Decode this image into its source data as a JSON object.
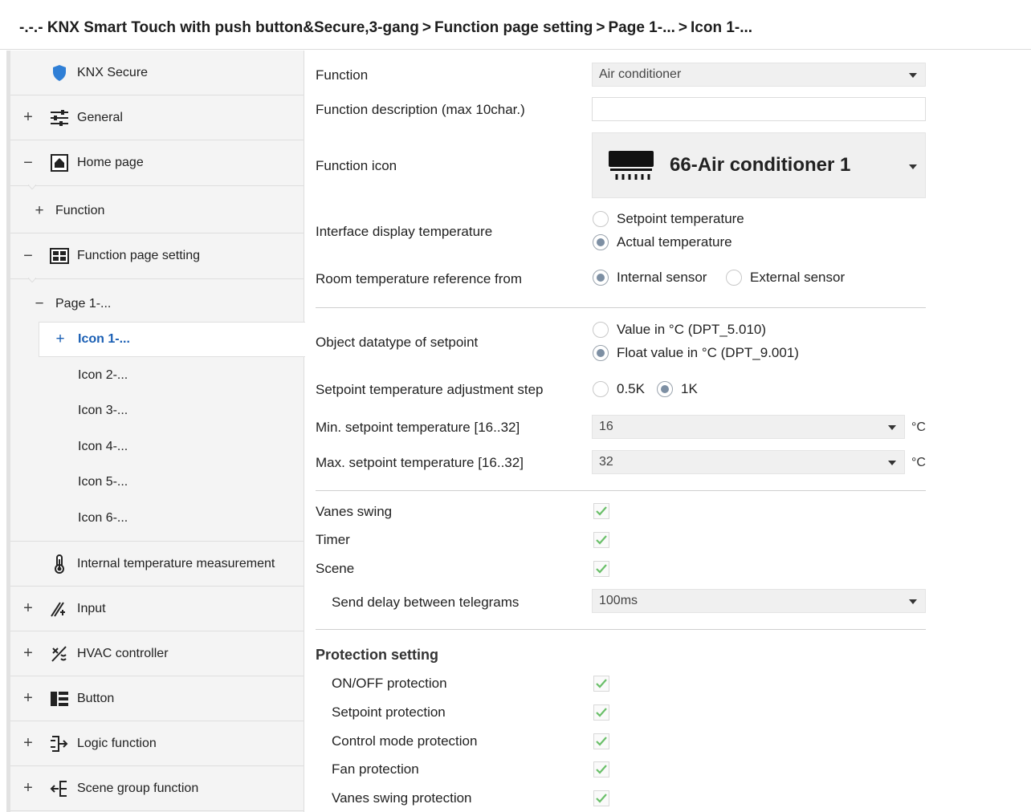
{
  "breadcrumb": {
    "parts": [
      "-.-.- KNX Smart Touch with push button&Secure,3-gang",
      "Function page setting",
      "Page 1-...",
      "Icon 1-..."
    ],
    "separator": ">"
  },
  "sidebar": {
    "items": [
      {
        "label": "KNX Secure",
        "expander": "",
        "icon": "shield-icon"
      },
      {
        "label": "General",
        "expander": "+",
        "icon": "sliders-icon"
      },
      {
        "label": "Home page",
        "expander": "−",
        "icon": "home-icon"
      },
      {
        "label": "Function",
        "expander": "+"
      },
      {
        "label": "Function page setting",
        "expander": "−",
        "icon": "grid-icon"
      },
      {
        "label": "Page 1-...",
        "expander": "−"
      },
      {
        "label": "Icon 1-...",
        "expander": "+",
        "active": true
      },
      {
        "label": "Icon 2-..."
      },
      {
        "label": "Icon 3-..."
      },
      {
        "label": "Icon 4-..."
      },
      {
        "label": "Icon 5-..."
      },
      {
        "label": "Icon 6-..."
      },
      {
        "label": "Internal temperature measurement",
        "expander": "",
        "icon": "thermometer-icon"
      },
      {
        "label": "Input",
        "expander": "+",
        "icon": "input-icon"
      },
      {
        "label": "HVAC controller",
        "expander": "+",
        "icon": "hvac-icon"
      },
      {
        "label": "Button",
        "expander": "+",
        "icon": "button-icon"
      },
      {
        "label": "Logic function",
        "expander": "+",
        "icon": "logic-icon"
      },
      {
        "label": "Scene group function",
        "expander": "+",
        "icon": "scene-group-icon"
      }
    ],
    "accent_color": "#1a5fb4",
    "shield_color": "#2f7fd6"
  },
  "form": {
    "function": {
      "label": "Function",
      "value": "Air conditioner"
    },
    "function_description": {
      "label": "Function description (max 10char.)",
      "value": ""
    },
    "function_icon": {
      "label": "Function icon",
      "value": "66-Air conditioner 1",
      "icon": "air-conditioner-icon"
    },
    "interface_display_temperature": {
      "label": "Interface display temperature",
      "options": [
        "Setpoint temperature",
        "Actual temperature"
      ],
      "selected": "Actual temperature"
    },
    "room_temperature_reference": {
      "label": "Room temperature reference from",
      "options": [
        "Internal sensor",
        "External sensor"
      ],
      "selected": "Internal sensor"
    },
    "object_datatype_setpoint": {
      "label": "Object datatype of setpoint",
      "options": [
        "Value in °C (DPT_5.010)",
        "Float value in °C (DPT_9.001)"
      ],
      "selected": "Float value in °C (DPT_9.001)"
    },
    "setpoint_adjustment_step": {
      "label": "Setpoint temperature adjustment step",
      "options": [
        "0.5K",
        "1K"
      ],
      "selected": "1K"
    },
    "min_setpoint": {
      "label": "Min. setpoint temperature [16..32]",
      "value": "16",
      "unit": "°C"
    },
    "max_setpoint": {
      "label": "Max. setpoint temperature [16..32]",
      "value": "32",
      "unit": "°C"
    },
    "vanes_swing": {
      "label": "Vanes swing",
      "checked": true
    },
    "timer": {
      "label": "Timer",
      "checked": true
    },
    "scene": {
      "label": "Scene",
      "checked": true
    },
    "send_delay": {
      "label": "Send delay between telegrams",
      "value": "100ms"
    },
    "protection": {
      "title": "Protection setting",
      "items": [
        {
          "label": "ON/OFF protection",
          "checked": true
        },
        {
          "label": "Setpoint protection",
          "checked": true
        },
        {
          "label": "Control mode protection",
          "checked": true
        },
        {
          "label": "Fan protection",
          "checked": true
        },
        {
          "label": "Vanes swing protection",
          "checked": true
        }
      ]
    },
    "check_color": "#6abf69",
    "radio_selected_color": "#7d8fa3"
  }
}
